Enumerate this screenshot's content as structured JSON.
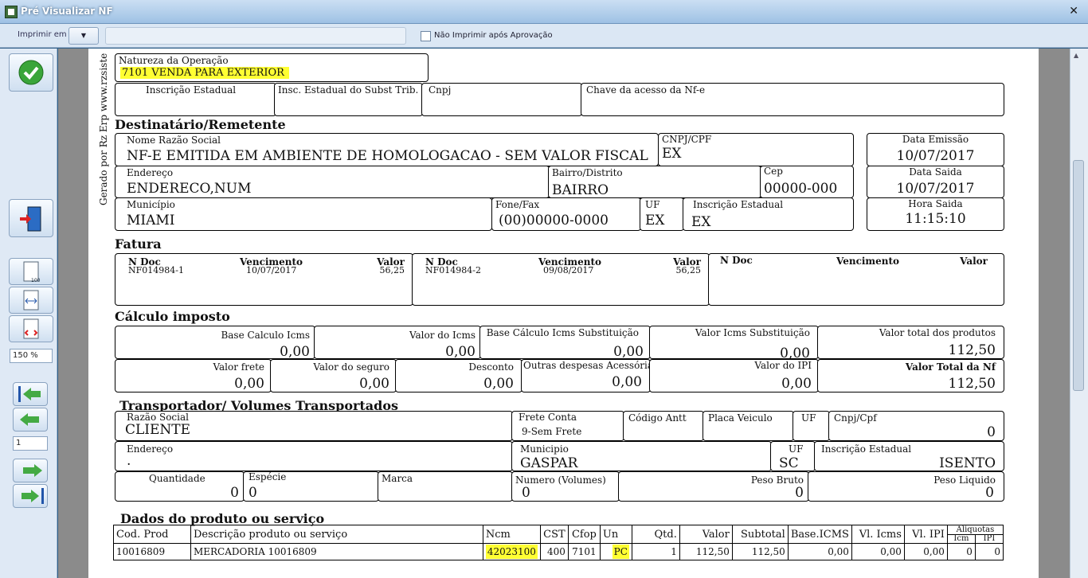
{
  "window": {
    "title": "Pré Visualizar NF",
    "close": "✕"
  },
  "toolbar": {
    "print_label": "Imprimir em",
    "dropdown": "▼",
    "no_print_label": "Não Imprimir após Aprovação"
  },
  "side": {
    "zoom": "150 %",
    "page": "1"
  },
  "doc": {
    "vertical_text": "Gerado por Rz Erp www.rzsiste",
    "natureza": {
      "label": "Natureza da Operação",
      "value": "7101   VENDA PARA EXTERIOR"
    },
    "ie_label": "Inscrição Estadual",
    "ie_st_label": "Insc. Estadual do Subst Trib.",
    "cnpj_label": "Cnpj",
    "chave_label": "Chave da acesso da Nf-e",
    "dest": {
      "section": "Destinatário/Remetente",
      "nome_label": "Nome Razão Social",
      "nome": "NF-E EMITIDA EM AMBIENTE DE HOMOLOGACAO - SEM VALOR FISCAL",
      "cnpj_label": "CNPJ/CPF",
      "cnpj": "EX",
      "emissao_label": "Data Emissão",
      "emissao": "10/07/2017",
      "end_label": "Endereço",
      "end": "ENDERECO,NUM",
      "bairro_label": "Bairro/Distrito",
      "bairro": "BAIRRO",
      "cep_label": "Cep",
      "cep": "00000-000",
      "saida_label": "Data Saida",
      "saida": "10/07/2017",
      "mun_label": "Município",
      "mun": "MIAMI",
      "fone_label": "Fone/Fax",
      "fone": "(00)00000-0000",
      "uf_label": "UF",
      "uf": "EX",
      "ie_label": "Inscrição Estadual",
      "ie": "EX",
      "hora_label": "Hora Saida",
      "hora": "11:15:10"
    },
    "fatura": {
      "section": "Fatura",
      "h_doc": "N Doc",
      "h_venc": "Vencimento",
      "h_valor": "Valor",
      "items": [
        {
          "doc": "NF014984-1",
          "venc": "10/07/2017",
          "valor": "56,25"
        },
        {
          "doc": "NF014984-2",
          "venc": "09/08/2017",
          "valor": "56,25"
        }
      ]
    },
    "imposto": {
      "section": "Cálculo imposto",
      "base_icms_l": "Base Calculo Icms",
      "base_icms": "0,00",
      "valor_icms_l": "Valor do Icms",
      "valor_icms": "0,00",
      "base_st_l": "Base Cálculo Icms Substituição",
      "base_st": "0,00",
      "valor_st_l": "Valor Icms Substituição",
      "valor_st": "0,00",
      "total_prod_l": "Valor total dos produtos",
      "total_prod": "112,50",
      "frete_l": "Valor frete",
      "frete": "0,00",
      "seguro_l": "Valor do seguro",
      "seguro": "0,00",
      "desconto_l": "Desconto",
      "desconto": "0,00",
      "outras_l": "Outras despesas Acessórias",
      "outras": "0,00",
      "ipi_l": "Valor do IPI",
      "ipi": "0,00",
      "total_nf_l": "Valor Total da Nf",
      "total_nf": "112,50"
    },
    "transp": {
      "section": "Transportador/ Volumes Transportados",
      "razao_l": "Razão Social",
      "razao": "CLIENTE",
      "frete_l": "Frete Conta",
      "frete": "9-Sem Frete",
      "antt_l": "Código Antt",
      "placa_l": "Placa Veiculo",
      "uf_l": "UF",
      "cnpj_l": "Cnpj/Cpf",
      "cnpj": "0",
      "end_l": "Endereço",
      "end": ".",
      "mun_l": "Municipio",
      "mun": "GASPAR",
      "uf2_l": "UF",
      "uf2": "SC",
      "ie_l": "Inscrição Estadual",
      "ie": "ISENTO",
      "qtd_l": "Quantidade",
      "qtd": "0",
      "especie_l": "Espécie",
      "especie": "0",
      "marca_l": "Marca",
      "num_l": "Numero (Volumes)",
      "num": "0",
      "pbruto_l": "Peso Bruto",
      "pbruto": "0",
      "pliq_l": "Peso Liquido",
      "pliq": "0"
    },
    "produtos": {
      "section": "Dados do produto ou serviço",
      "headers": {
        "cod": "Cod. Prod",
        "desc": "Descrição produto ou serviço",
        "ncm": "Ncm",
        "cst": "CST",
        "cfop": "Cfop",
        "un": "Un",
        "qtd": "Qtd.",
        "valor": "Valor",
        "subtotal": "Subtotal",
        "base": "Base.ICMS",
        "vicms": "Vl. Icms",
        "vipi": "Vl. IPI",
        "aliq": "Aliquotas",
        "icm": "Icm",
        "ipi": "IPI"
      },
      "row": {
        "cod": "10016809",
        "desc": "MERCADORIA 10016809",
        "ncm": "42023100",
        "cst": "400",
        "cfop": "7101",
        "un": "PC",
        "qtd": "1",
        "valor": "112,50",
        "subtotal": "112,50",
        "base": "0,00",
        "vicms": "0,00",
        "vipi": "0,00",
        "icm": "0",
        "ipi": "0"
      }
    }
  }
}
